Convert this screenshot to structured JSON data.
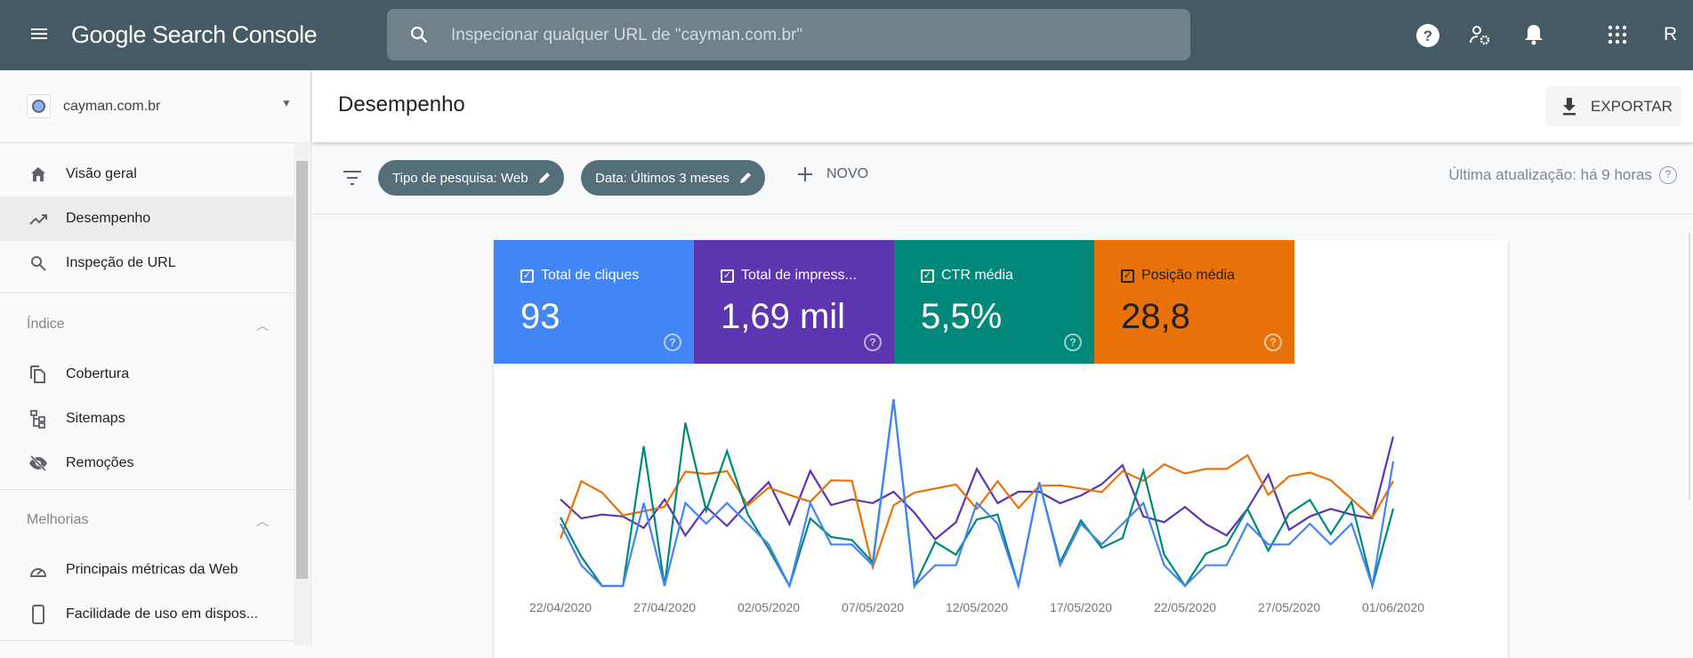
{
  "topbar": {
    "logo_text": "Google Search Console",
    "search_placeholder": "Inspecionar qualquer URL de \"cayman.com.br\"",
    "avatar_letter": "R"
  },
  "sidebar": {
    "property": "cayman.com.br",
    "items": [
      {
        "label": "Visão geral",
        "icon": "home-icon"
      },
      {
        "label": "Desempenho",
        "icon": "trending-up-icon",
        "selected": true
      },
      {
        "label": "Inspeção de URL",
        "icon": "search-icon"
      }
    ],
    "sections": [
      {
        "title": "Índice",
        "items": [
          {
            "label": "Cobertura",
            "icon": "copy-icon"
          },
          {
            "label": "Sitemaps",
            "icon": "sitemap-icon"
          },
          {
            "label": "Remoções",
            "icon": "eye-off-icon"
          }
        ]
      },
      {
        "title": "Melhorias",
        "items": [
          {
            "label": "Principais métricas da Web",
            "icon": "speed-icon"
          },
          {
            "label": "Facilidade de uso em dispos...",
            "icon": "phone-icon"
          }
        ]
      }
    ]
  },
  "header": {
    "title": "Desempenho",
    "export_label": "EXPORTAR"
  },
  "filters": {
    "chips": [
      "Tipo de pesquisa: Web",
      "Data: Últimos 3 meses"
    ],
    "new_label": "NOVO",
    "last_update": "Última atualização: há 9 horas"
  },
  "metrics": [
    {
      "label": "Total de cliques",
      "value": "93",
      "color": "#4285f4",
      "text_color": "#ffffff"
    },
    {
      "label": "Total de impress...",
      "value": "1,69 mil",
      "color": "#5e35b1",
      "text_color": "#ffffff"
    },
    {
      "label": "CTR média",
      "value": "5,5%",
      "color": "#00897b",
      "text_color": "#ffffff"
    },
    {
      "label": "Posição média",
      "value": "28,8",
      "color": "#e8710a",
      "text_color": "#212121"
    }
  ],
  "chart_data": {
    "type": "line",
    "x_start": "22/04/2020",
    "x_end": "01/06/2020",
    "tick_labels": [
      "22/04/2020",
      "27/04/2020",
      "02/05/2020",
      "07/05/2020",
      "12/05/2020",
      "17/05/2020",
      "22/05/2020",
      "27/05/2020",
      "01/06/2020"
    ],
    "grid": false,
    "independent_axes": true,
    "series": [
      {
        "name": "Total de impress...",
        "color": "#5e35b1",
        "values": [
          43,
          33,
          35,
          34,
          28,
          43,
          24,
          39,
          29,
          41,
          52,
          30,
          58,
          40,
          43,
          41,
          47,
          36,
          22,
          31,
          59,
          41,
          47,
          47,
          41,
          45,
          51,
          61,
          34,
          31,
          39,
          30,
          24,
          38,
          56,
          27,
          34,
          38,
          35,
          33,
          76
        ]
      },
      {
        "name": "Posição média",
        "color": "#e8710a",
        "inverted": true,
        "values": [
          33.3,
          20.7,
          23.2,
          28.2,
          27.3,
          26.3,
          18.6,
          19.1,
          18.5,
          26.0,
          22.1,
          23.7,
          25.2,
          20.5,
          20.6,
          39.6,
          26.0,
          23.2,
          22.3,
          21.4,
          26.8,
          20.7,
          26.6,
          21.7,
          21.6,
          22.3,
          23.1,
          18.5,
          20.6,
          17.0,
          19.0,
          18.0,
          18.0,
          15.0,
          23.7,
          19.6,
          18.8,
          20.5,
          24.6,
          28.7,
          20.7
        ]
      },
      {
        "name": "CTR média",
        "color": "#00897b",
        "values": [
          7.0,
          3.0,
          0,
          0,
          14.3,
          0,
          16.7,
          7.7,
          13.8,
          7.3,
          3.8,
          0,
          6.9,
          5.0,
          4.7,
          2.4,
          19.1,
          0,
          4.5,
          3.2,
          6.8,
          7.3,
          0,
          10.6,
          2.4,
          6.7,
          3.9,
          4.9,
          11.8,
          3.2,
          0,
          3.3,
          4.2,
          7.9,
          3.6,
          7.4,
          8.8,
          5.3,
          8.6,
          0,
          7.9
        ]
      },
      {
        "name": "Total de cliques",
        "color": "#4285f4",
        "values": [
          3,
          1,
          0,
          0,
          4,
          0,
          4,
          3,
          4,
          3,
          2,
          0,
          4,
          2,
          2,
          1,
          9,
          0,
          1,
          1,
          4,
          3,
          0,
          5,
          1,
          3,
          2,
          3,
          4,
          1,
          0,
          1,
          1,
          3,
          2,
          2,
          3,
          2,
          3,
          0,
          6
        ]
      }
    ]
  }
}
